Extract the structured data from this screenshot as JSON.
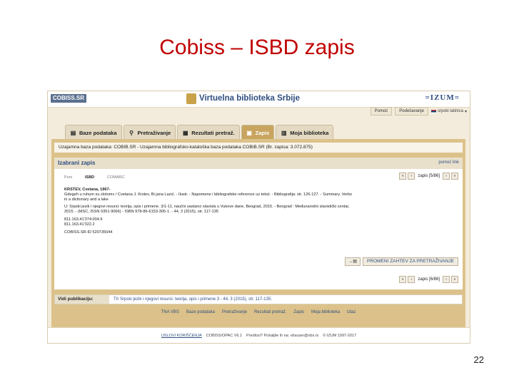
{
  "slide": {
    "title": "Cobiss – ISBD zapis",
    "page_number": "22"
  },
  "header": {
    "logo": "COBISS.SR",
    "site_title": "Virtuelna biblioteka Srbije",
    "partner_logo": "=IZUM="
  },
  "utility": {
    "help": "Pomoć",
    "settings": "Podešavanje",
    "language": "srpski latinica"
  },
  "tabs": [
    {
      "label": "Baze podataka"
    },
    {
      "label": "Pretraživanje"
    },
    {
      "label": "Rezultati pretraž."
    },
    {
      "label": "Zapis"
    },
    {
      "label": "Moja biblioteka"
    }
  ],
  "db_bar": "Uzajamna baza podataka: COBIB.SR - Uzajamna bibliografsko-kataloška baza podataka COBIB.SR (Br. zapisa: 3.072.875)",
  "panel": {
    "title": "Izabrani zapis",
    "link": "pomoć link",
    "subtabs": [
      "Puni",
      "ISBD",
      "COMARC"
    ],
    "pager_top": "zapis [5/86]",
    "pager_bottom": "zapis [6/86]",
    "record": [
      "KRSTEV, Cvetana, 1967-",
      "Gdegeh u ruhum su zlotomv / Cvetana J. Krstev, Bi jana Lazić. - Ilustr. - Napomene i bibliografske reference uz tekst. - Bibliografija: str. 126-127. - Summary. Verbs",
      "in a dictionary and a lake",
      "",
      "U: Srpski jezik i njegovi resursi: teorija, opis i primene. 3/1-11, naučni sastanci slavista u Vukove dane, Beograd, 2015. - Beograd : Međunarodni slavistički centar,",
      "2015. - (MSC, ISSN 0351-9066) - ISBN 978-86-6153-305-1. - 44, 3 (2015), str. 117-135",
      "",
      "811.163.41'374:004.9",
      "811.163.41'322.2",
      "",
      "COBISS.SR-ID 520735044"
    ],
    "modify_button": "PROMENI ZAHTEV ZA PRETRAŽIVANJE"
  },
  "publication": {
    "label": "Vidi publikaciju:",
    "value": "TIr Srpski jezik i njegovi resursi: teorija, opis i primene 3 - 44, 3 (2015), str. 117-135."
  },
  "footer_nav": [
    "TNA VBS",
    "Baze podataka",
    "Pretraživanje",
    "Rezultati pretraž.",
    "Zapis",
    "Moja biblioteka",
    "Izlaz"
  ],
  "bottom": {
    "terms": "USLOVI KORIŠĆENJA",
    "version": "COBISS/OPAC V6.1",
    "suggestions": "Predlozi? Pošaljite ih na: vbsuser@vbs.rs",
    "copyright": "© IZUM 1997-2017"
  }
}
